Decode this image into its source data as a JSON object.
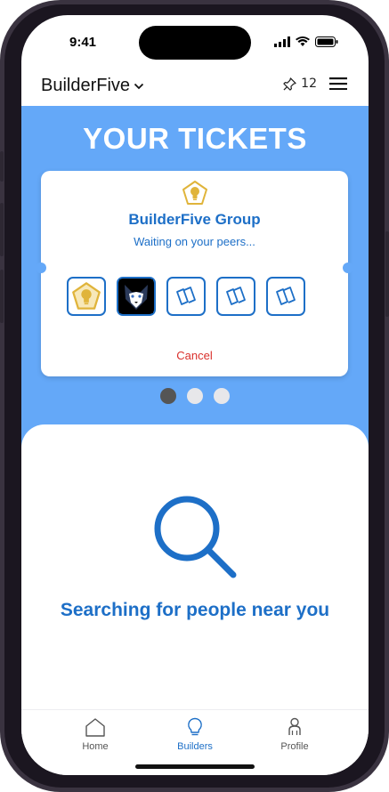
{
  "status": {
    "time": "9:41"
  },
  "appbar": {
    "brand": "BuilderFive",
    "pin_count": "12"
  },
  "hero": {
    "title": "YOUR TICKETS"
  },
  "card": {
    "group_title": "BuilderFive Group",
    "group_subtitle": "Waiting on your peers...",
    "cancel_label": "Cancel",
    "slots": [
      "bulb-pentagon-icon",
      "husky-avatar",
      "ticket-icon",
      "ticket-icon",
      "ticket-icon"
    ]
  },
  "pager": {
    "count": 3,
    "active": 0
  },
  "search": {
    "text": "Searching for people near you"
  },
  "tabs": [
    {
      "label": "Home"
    },
    {
      "label": "Builders"
    },
    {
      "label": "Profile"
    }
  ],
  "colors": {
    "accent": "#1d6fc7",
    "hero": "#64a8f8",
    "danger": "#d9302c",
    "gold": "#e0b43a"
  }
}
